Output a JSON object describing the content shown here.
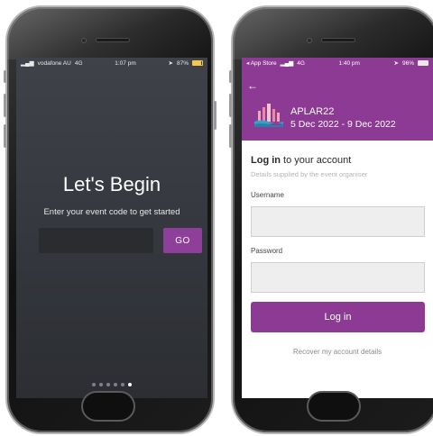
{
  "left_phone": {
    "status": {
      "carrier": "vodafone AU",
      "network": "4G",
      "time": "1:07 pm",
      "battery": "87%",
      "battery_level": 0.87
    },
    "title": "Let's Begin",
    "subtitle": "Enter your event code to get started",
    "code_input": {
      "value": "",
      "placeholder": ""
    },
    "go_label": "GO",
    "pagination": {
      "total": 6,
      "active_index": 5
    }
  },
  "right_phone": {
    "status": {
      "back_app": "App Store",
      "network": "4G",
      "time": "1:40 pm",
      "battery": "96%",
      "battery_level": 0.96
    },
    "event": {
      "name": "APLAR22",
      "dates": "5 Dec 2022 - 9 Dec 2022",
      "logo_icon": "city-skyline-logo"
    },
    "login": {
      "heading_bold": "Log in",
      "heading_rest": " to your account",
      "note": "Details supplied by the event organiser",
      "username_label": "Username",
      "username_value": "",
      "password_label": "Password",
      "password_value": "",
      "button_label": "Log in",
      "recover_label": "Recover my account details"
    }
  },
  "colors": {
    "accent_purple": "#8d3a95",
    "dark_background": "#34373d"
  }
}
